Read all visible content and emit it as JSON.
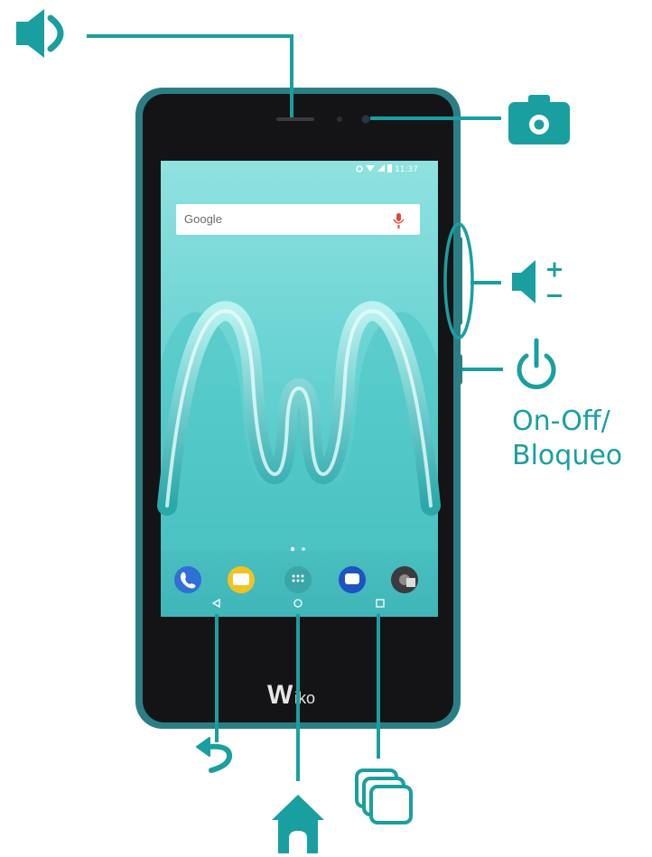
{
  "labels": {
    "power_line1": "On-Off/",
    "power_line2": "Bloqueo"
  },
  "phone": {
    "brand_w": "W",
    "brand_rest": "iko",
    "status_time": "11:37",
    "search_logo": "Google"
  },
  "colors": {
    "accent": "#1a9fa0",
    "phone_frame": "#1f6f74",
    "bezel": "#141416",
    "screen": "#6fd6d6"
  },
  "icons": {
    "speaker": "speaker-icon",
    "camera": "camera-icon",
    "volume": "volume-icon",
    "power": "power-icon",
    "back": "back-arrow-icon",
    "home": "home-icon",
    "recents": "recent-apps-icon"
  }
}
